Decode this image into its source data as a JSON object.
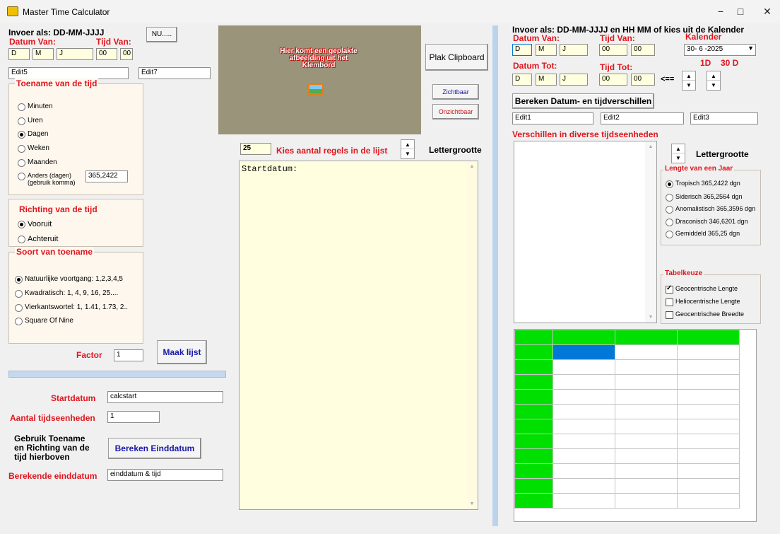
{
  "window": {
    "title": "Master Time Calculator",
    "minimize": "−",
    "maximize": "□",
    "close": "✕"
  },
  "left": {
    "invoer": "Invoer als: DD-MM-JJJJ",
    "nu_btn": "NU.....",
    "datum_van": "Datum Van:",
    "tijd_van": "Tijd Van:",
    "d": "D",
    "m": "M",
    "j": "J",
    "hh": "00",
    "mm": "00",
    "edit5": "Edit5",
    "edit7": "Edit7",
    "toename_title": "Toename van de tijd",
    "toename": [
      "Minuten",
      "Uren",
      "Dagen",
      "Weken",
      "Maanden"
    ],
    "anders_1": "Anders (dagen)",
    "anders_2": "(gebruik komma)",
    "anders_val": "365,2422",
    "richting_title": "Richting van de tijd",
    "vooruit": "Vooruit",
    "achteruit": "Achteruit",
    "soort_title": "Soort van toename",
    "soort": [
      "Natuurlijke voortgang: 1,2,3,4,5",
      "Kwadratisch: 1, 4, 9, 16, 25....",
      "Vierkantswortel: 1, 1.41, 1.73, 2..",
      "Square Of Nine"
    ],
    "factor_lbl": "Factor",
    "factor_val": "1",
    "maak_lijst": "Maak lijst",
    "startdatum_lbl": "Startdatum",
    "startdatum_val": "calcstart",
    "aantal_lbl": "Aantal tijdseenheden",
    "aantal_val": "1",
    "gebruik_1": "Gebruik Toename",
    "gebruik_2": "en Richting van de",
    "gebruik_3": "tijd hierboven",
    "bereken_eind": "Bereken Einddatum",
    "berekende_lbl": "Berekende einddatum",
    "berekende_val": "einddatum & tijd"
  },
  "middle": {
    "placeholder_1": "Hier komt een geplakte",
    "placeholder_2": "afbeelding uit het",
    "placeholder_3": "Klembord",
    "plak": "Plak Clipboard",
    "zichtbaar": "Zichtbaar",
    "onzichtbaar": "Onzichtbaar",
    "regels_val": "25",
    "regels_lbl": "Kies aantal regels in de lijst",
    "lettergrootte": "Lettergrootte",
    "list_text": "Startdatum:"
  },
  "right": {
    "invoer": "Invoer als: DD-MM-JJJJ en HH MM of kies uit de Kalender",
    "datum_van": "Datum Van:",
    "tijd_van": "Tijd Van:",
    "kalender": "Kalender",
    "d": "D",
    "m": "M",
    "j": "J",
    "hh": "00",
    "mm": "00",
    "kalender_val": "30- 6 -2025",
    "datum_tot": "Datum Tot:",
    "tijd_tot": "Tijd Tot:",
    "arrow": "<==",
    "one_d": "1D",
    "thirty_d": "30 D",
    "bereken_btn": "Bereken Datum- en tijdverschillen",
    "edit1": "Edit1",
    "edit2": "Edit2",
    "edit3": "Edit3",
    "verschillen": "Verschillen in diverse tijdseenheden",
    "lettergrootte": "Lettergrootte",
    "lengte_title": "Lengte van een Jaar",
    "lengte": [
      "Tropisch 365,2422 dgn",
      "Siderisch 365,2564 dgn",
      "Anomalistisch 365,3596 dgn",
      "Draconisch 346,6201 dgn",
      "Gemiddeld 365,25 dgn"
    ],
    "tabel_title": "Tabelkeuze",
    "tabel": [
      "Geocentrische Lengte",
      "Heliocentrische Lengte",
      "Geocentrischee Breedte"
    ]
  },
  "colors": {
    "accent_red": "#e0161e",
    "grid_green": "#00e000",
    "selection_blue": "#0078d7"
  }
}
